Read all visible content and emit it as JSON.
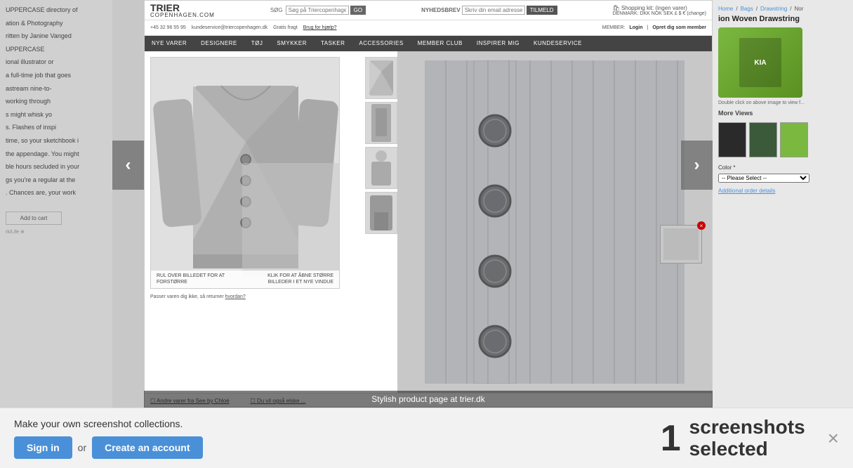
{
  "bg": {
    "left_sidebar": {
      "texts": [
        "UPPERCASE directory of",
        "ation & Photography",
        "ritten by Janine Vanged",
        "UPPERCASE",
        "ional illustrator or",
        "a full-time job that goes",
        "astream nine-to-",
        "working through",
        "s might whisk yo",
        "s. Flashes of inspi",
        "time, so your sketchbook i",
        "the appendage. You might",
        "ble hours secluded in your",
        "gs you're a regular at the",
        ". Chances are, your work"
      ]
    }
  },
  "store": {
    "logo_line1": "TRIER",
    "logo_line2": "COPENHAGEN.COM",
    "search_label": "SØG",
    "search_placeholder": "Søg på Triercopenhagen.dk",
    "search_button": "GO",
    "newsletter_label": "NYHEDSBREV",
    "newsletter_placeholder": "Skriv din email adresse",
    "newsletter_button": "TILMELD",
    "shopping_kit": "Shopping kit: (ingen varer)",
    "country_label": "DENMARK: DKK NOK SEK £ $ € (change)",
    "member_label": "MEMBER:",
    "login_link": "Login",
    "register_link": "Opret dig som member",
    "phone": "+45 32 96 55 95",
    "email": "kundeservice@triercopenhagen.dk",
    "gratis_fragt": "Gratis fragt",
    "help": "Brug for hjælp?",
    "nav_items": [
      "NYE VARER",
      "DESIGNERE",
      "TØJ",
      "SMYKKER",
      "TASKER",
      "ACCESSORIES",
      "MEMBER CLUB",
      "INSPIRER MIG",
      "KUNDESERVICE"
    ],
    "zoom_hint1": "RUL OVER BILLEDET FOR AT FORSTØRRE",
    "zoom_hint2": "KLIK FOR AT ÅBNE STØRRE BILLEDER I ET NYE VINDUE",
    "bottom_link1": "Andre varer fra See by Chloé",
    "bottom_link2": "Du vil også elske ...",
    "fit_text": "Passer varen dig ikke, så returner",
    "fit_suffix": "hvordan?"
  },
  "right_sidebar": {
    "title": "ion Woven Drawstring",
    "link1": "Home",
    "link2": "Bags",
    "link3": "Drawstring",
    "link4": "Nor",
    "image_note": "Double click on above image to view f...",
    "more_views": "More Views",
    "color_label": "Color *",
    "select_placeholder": "-- Please Select --",
    "order_details": "Additional order details"
  },
  "caption": {
    "text": "Stylish product page at trier.dk"
  },
  "bottom_bar": {
    "promo_text": "Make your own screenshot collections.",
    "signin_label": "Sign in",
    "or_text": "or",
    "create_account_label": "Create an account",
    "counter_number": "1",
    "counter_label_line1": "screenshots",
    "counter_label_line2": "selected",
    "close_icon": "×"
  },
  "nav_arrows": {
    "left": "‹",
    "right": "›"
  },
  "thumbnail_popup": {
    "close": "×"
  }
}
